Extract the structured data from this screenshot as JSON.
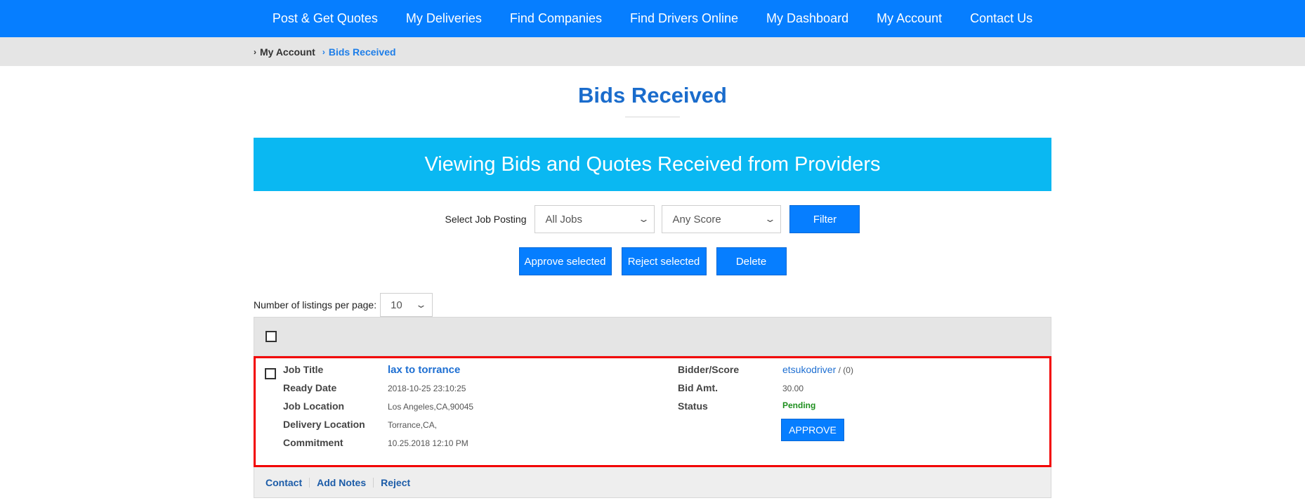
{
  "nav": {
    "items": [
      "Post & Get Quotes",
      "My Deliveries",
      "Find Companies",
      "Find Drivers Online",
      "My Dashboard",
      "My Account",
      "Contact Us"
    ]
  },
  "breadcrumb": {
    "items": [
      "My Account",
      "Bids Received"
    ]
  },
  "page": {
    "title": "Bids Received",
    "banner": "Viewing Bids and Quotes Received from Providers"
  },
  "filters": {
    "label": "Select Job Posting",
    "job_select": "All Jobs",
    "score_select": "Any Score",
    "filter_button": "Filter"
  },
  "actions": {
    "approve_selected": "Approve selected",
    "reject_selected": "Reject selected",
    "delete": "Delete"
  },
  "pagination": {
    "label": "Number of listings per page:",
    "per_page": "10"
  },
  "bid": {
    "job_title_label": "Job Title",
    "job_title": "lax to torrance",
    "ready_date_label": "Ready Date",
    "ready_date": "2018-10-25 23:10:25",
    "job_location_label": "Job Location",
    "job_location": "Los Angeles,CA,90045",
    "delivery_location_label": "Delivery Location",
    "delivery_location": "Torrance,CA,",
    "commitment_label": "Commitment",
    "commitment": "10.25.2018 12:10 PM",
    "bidder_label": "Bidder/Score",
    "bidder": "etsukodriver",
    "score": " / (0)",
    "bid_amt_label": "Bid Amt.",
    "bid_amt": "30.00",
    "status_label": "Status",
    "status": "Pending",
    "approve_button": "APPROVE"
  },
  "bid_actions": {
    "contact": "Contact",
    "add_notes": "Add Notes",
    "reject": "Reject"
  },
  "colors": {
    "nav_bg": "#067eff",
    "banner_bg": "#0ab8f2",
    "title": "#1a6ccc",
    "highlight_border": "#f20000",
    "status_pending": "#1e8f1e"
  }
}
